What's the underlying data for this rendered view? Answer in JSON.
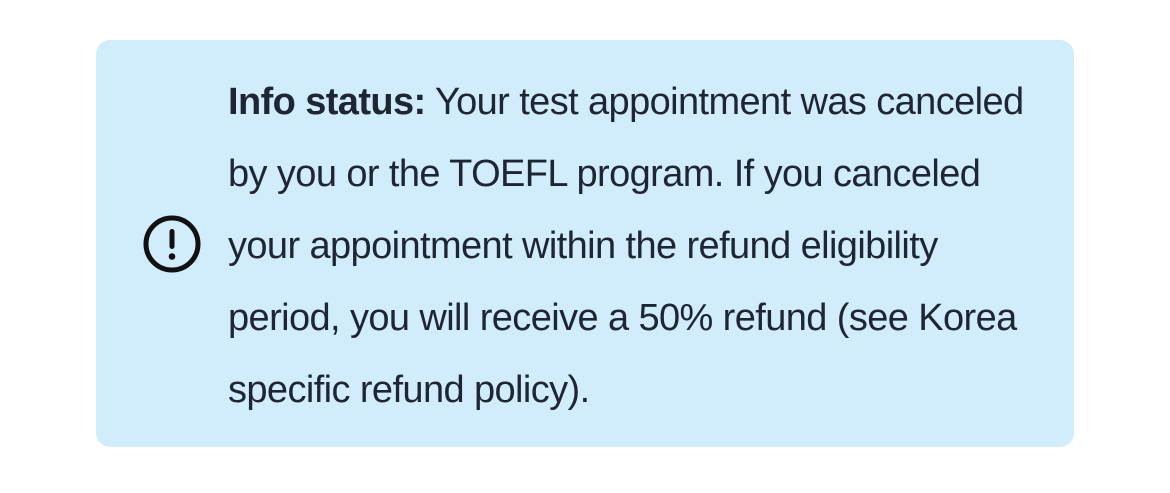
{
  "alert": {
    "icon": "exclamation-circle-icon",
    "label": "Info status:",
    "message": "Your test appointment was canceled by you or the TOEFL program. If you canceled your appointment within the refund eligibility period, you will receive a 50% refund (see Korea specific refund policy).",
    "background_color": "#d1ecfb",
    "text_color": "#1f2633"
  }
}
